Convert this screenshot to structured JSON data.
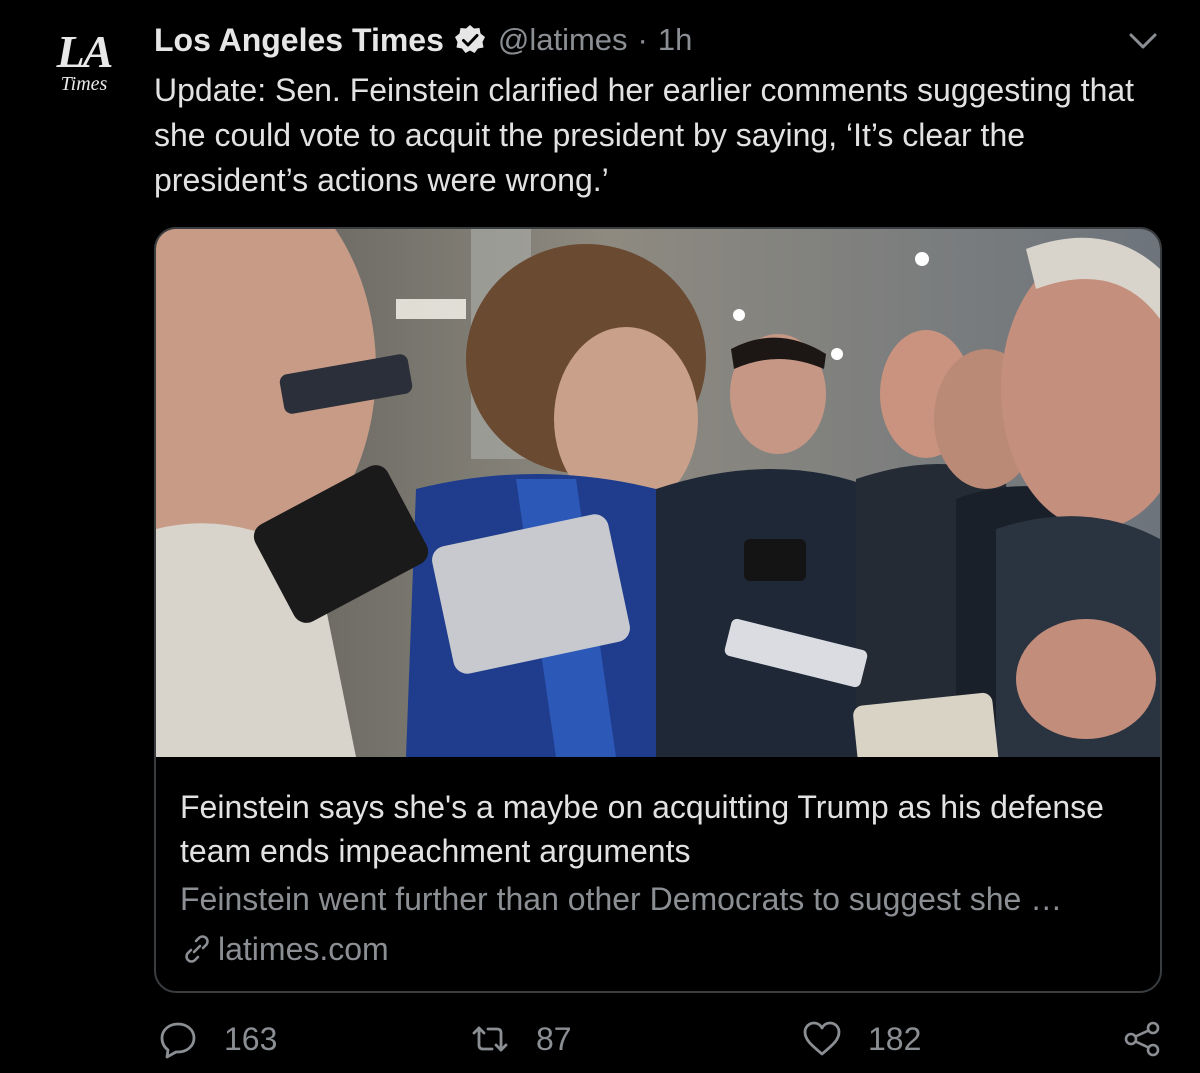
{
  "avatar": {
    "logo_line1": "LA",
    "logo_line2": "Times"
  },
  "header": {
    "name": "Los Angeles Times",
    "handle": "@latimes",
    "separator": "·",
    "time": "1h"
  },
  "tweet": {
    "text": "Update: Sen. Feinstein clarified her earlier comments suggesting that she could vote to acquit the president by saying, ‘It’s clear the president’s actions were wrong.’"
  },
  "card": {
    "title": "Feinstein says she's a maybe on acquitting Trump as his defense team ends impeachment arguments",
    "description": "Feinstein went further than other Democrats to suggest she …",
    "domain": "latimes.com"
  },
  "actions": {
    "replies": "163",
    "retweets": "87",
    "likes": "182"
  },
  "icons": {
    "verified": "verified-badge-icon",
    "menu": "chevron-down-icon",
    "link": "link-icon",
    "reply": "reply-icon",
    "retweet": "retweet-icon",
    "like": "heart-icon",
    "share": "share-icon"
  },
  "colors": {
    "background": "#000000",
    "text_primary": "#e2e2e2",
    "text_secondary": "#8b8f94",
    "card_border": "#3a3d40"
  }
}
